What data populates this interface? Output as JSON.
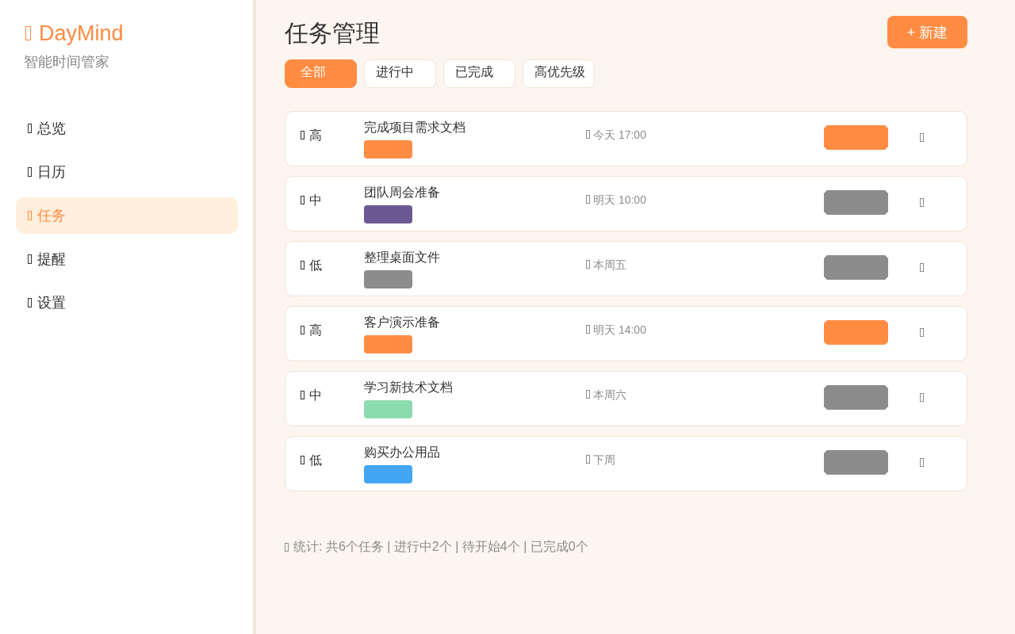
{
  "sidebar": {
    "brand": "DayMind",
    "subtitle": "智能时间管家",
    "nav": [
      {
        "label": "总览",
        "selected": false
      },
      {
        "label": "日历",
        "selected": false
      },
      {
        "label": "任务",
        "selected": true
      },
      {
        "label": "提醒",
        "selected": false
      },
      {
        "label": "设置",
        "selected": false
      }
    ]
  },
  "header": {
    "title": "任务管理",
    "new_button": "+ 新建"
  },
  "filters": [
    {
      "label": "全部",
      "selected": true
    },
    {
      "label": "进行中",
      "selected": false
    },
    {
      "label": "已完成",
      "selected": false
    },
    {
      "label": "高优先级",
      "selected": false
    }
  ],
  "tasks": [
    {
      "priority": "高",
      "title": "完成项目需求文档",
      "tag": {
        "color": "#ff8c42"
      },
      "due": "今天 17:00",
      "badge": {
        "color": "#ff8c42"
      }
    },
    {
      "priority": "中",
      "title": "团队周会准备",
      "tag": {
        "color": "#6a5a94"
      },
      "due": "明天 10:00",
      "badge": {
        "color": "#8c8c8c"
      }
    },
    {
      "priority": "低",
      "title": "整理桌面文件",
      "tag": {
        "color": "#8c8c8c"
      },
      "due": "本周五",
      "badge": {
        "color": "#8c8c8c"
      }
    },
    {
      "priority": "高",
      "title": "客户演示准备",
      "tag": {
        "color": "#ff8c42"
      },
      "due": "明天 14:00",
      "badge": {
        "color": "#ff8c42"
      }
    },
    {
      "priority": "中",
      "title": "学习新技术文档",
      "tag": {
        "color": "#8cdab0"
      },
      "due": "本周六",
      "badge": {
        "color": "#8c8c8c"
      }
    },
    {
      "priority": "低",
      "title": "购买办公用品",
      "tag": {
        "color": "#42a6f5"
      },
      "due": "下周",
      "badge": {
        "color": "#8c8c8c"
      }
    }
  ],
  "stats": "统计: 共6个任务 | 进行中2个 | 待开始4个 | 已完成0个"
}
